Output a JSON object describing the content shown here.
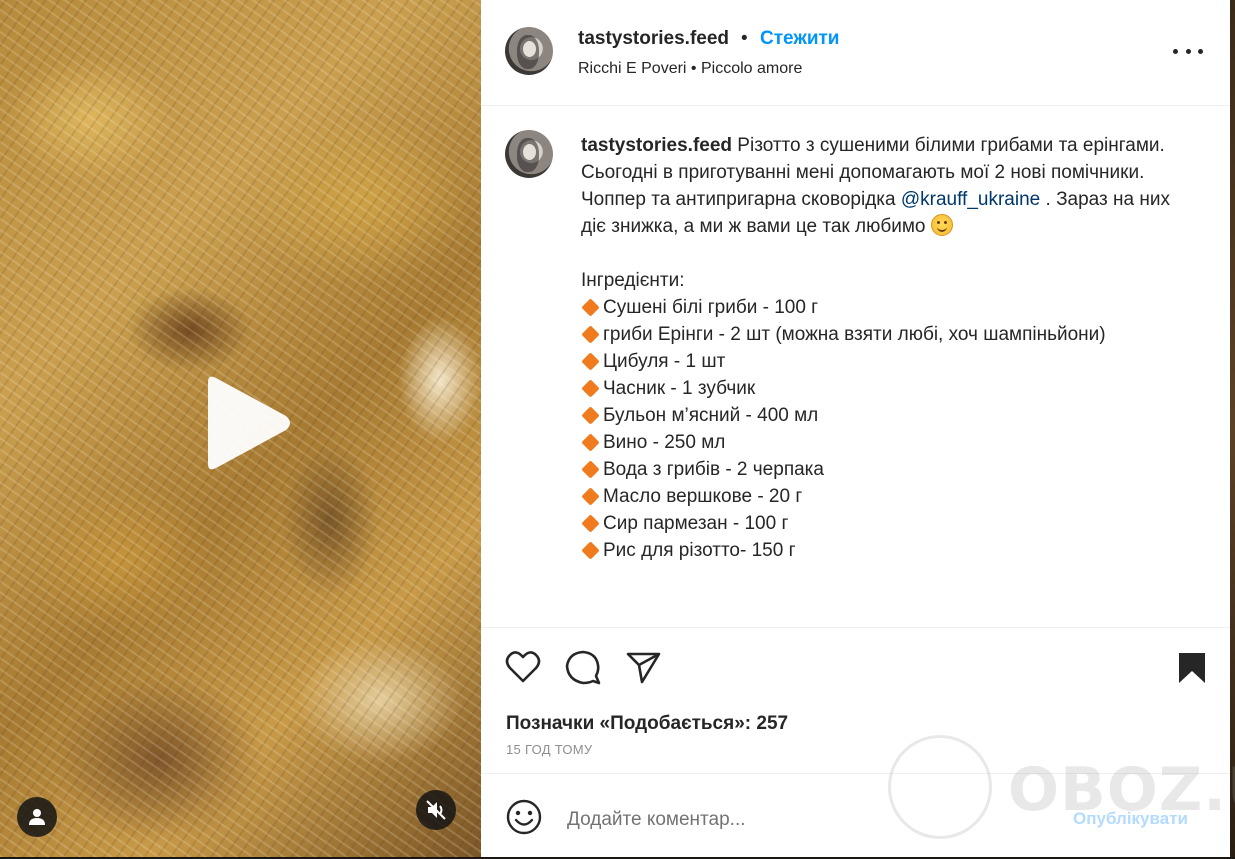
{
  "post": {
    "username": "tastystories.feed",
    "separator": "•",
    "follow_label": "Стежити",
    "music": "Ricchi E Poveri • Piccolo amore"
  },
  "caption": {
    "username": "tastystories.feed",
    "text_1": "Різотто з сушеними білими грибами та ерінгами.\nСьогодні в приготуванні мені допомагають мої 2 нові помічники.\nЧоппер та антипригарна сковорідка ",
    "mention": "@krauff_ukraine",
    "text_2": " . Зараз на них діє знижка, а ми ж вами це так любимо ",
    "ingredients_title": "Інгредієнти:",
    "ingredients": [
      "Сушені білі гриби - 100 г",
      "гриби Ерінги - 2 шт (можна взяти любі, хоч шампіньйони)",
      "Цибуля - 1 шт",
      "Часник - 1 зубчик",
      "Бульон м’ясний - 400 мл",
      "Вино - 250 мл",
      "Вода з грибів - 2 черпака",
      "Масло вершкове - 20 г",
      "Сир пармезан - 100 г",
      "Рис для різотто- 150 г"
    ]
  },
  "actions": {
    "likes_text": "Позначки «Подобається»: 257",
    "time_text": "15 ГОД ТОМУ"
  },
  "comment": {
    "placeholder": "Додайте коментар...",
    "publish_label": "Опублікувати"
  },
  "watermark": {
    "text": "OBOZ.UA"
  },
  "colors": {
    "accent": "#0095f6",
    "mention": "#00376b",
    "ingredient_bullet": "#f07b1e"
  }
}
